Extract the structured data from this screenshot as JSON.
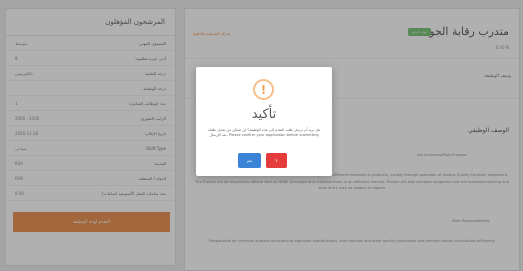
{
  "left_panel": {
    "header": "المرشحون المؤهلون",
    "rows": [
      {
        "label": "المستوى المهني:",
        "value": "متوسط"
      },
      {
        "label": "أدنى خبرة مطلوبة:",
        "value": "8"
      },
      {
        "label": "درجة التعليم:",
        "value": "بكالوريوس"
      },
      {
        "label": "درجة الوظيفة:",
        "value": ""
      },
      {
        "label": "عدد الوظائف الشاغرة:",
        "value": "1"
      },
      {
        "label": "الراتب الشهري:",
        "value": "2000 - 2500"
      },
      {
        "label": "تاريخ الإعلان:",
        "value": "2020-11-26"
      },
      {
        "label": "Shift Type:",
        "value": "صباحي"
      },
      {
        "label": "المدينة:",
        "value": "KSA"
      },
      {
        "label": "الدولة / المنطقة:",
        "value": "RAR"
      },
      {
        "label": "عدد ساعات العمل الأسبوعية (ساعات):",
        "value": "8.00"
      }
    ],
    "cta_label": "التقدم لهذه الوظيفة"
  },
  "right_panel": {
    "title": "متدرب رقابة الجودة",
    "badge": "دوام جزئي",
    "company": "شركة الشرقية والخليج",
    "meta": "8.00 ₪",
    "section1_label": "وصف الوظيفة",
    "section2_title": "الوصف الوظيفي",
    "job_summary": "Job Summary/Main Purpose",
    "paragraph": "The trainee will be responsible for carrying out inspections and analyses on different materials or products, usually through operation of various Quality Controls' equipment. The Trainee will be required to adhere with all QHSE principles and maintain them in an effective manner. Trainee will also complete programs that will maximize learning and time entry such as leaders in reports",
    "responsibilities": "Main Responsibilities",
    "duty": "Responsible for chemical analysis according to approved specifications, and methods and other quality procedures and perform control calculations efficiently"
  },
  "modal": {
    "icon": "!",
    "title": "تأكيد",
    "message": "هل تريد أن ترسل طلب التقدم إلى هذه الوظيفة؟ لن تتمكن من تعديل طلبك بعد الإرسال. Please confirm your application before submitting",
    "confirm_label": "نعم",
    "cancel_label": "لا"
  },
  "colors": {
    "accent_orange": "#e87b2f",
    "confirm_blue": "#3b83d6",
    "cancel_red": "#e43b3b",
    "warning_ring": "#f6c08b",
    "badge_green": "#5cb85c"
  }
}
